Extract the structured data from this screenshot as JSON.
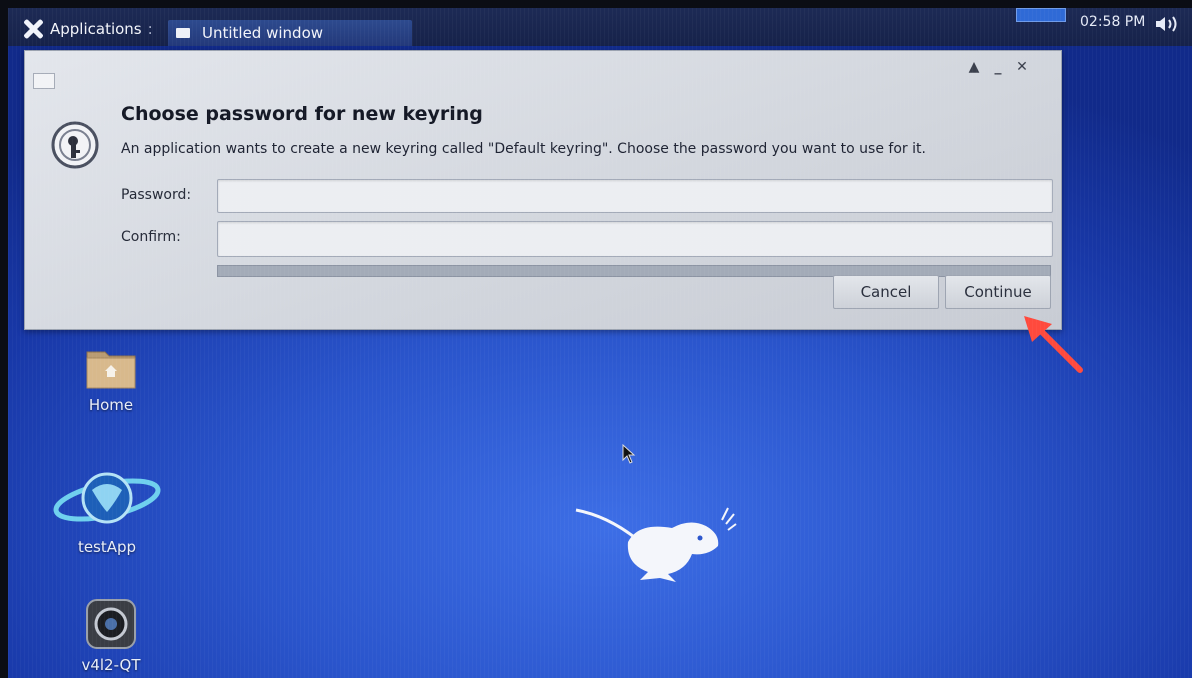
{
  "top_panel": {
    "applications_label": "Applications",
    "separator": ":",
    "taskbar_window_title": "Untitled window",
    "clock": "02:58 PM"
  },
  "dialog": {
    "heading": "Choose password for new keyring",
    "message": "An application wants to create a new keyring called \"Default keyring\". Choose the password you want to use for it.",
    "password_label": "Password:",
    "confirm_label": "Confirm:",
    "password_value": "",
    "confirm_value": "",
    "cancel_label": "Cancel",
    "continue_label": "Continue",
    "wm_buttons": {
      "shade": "▲",
      "minimize": "_",
      "close": "✕"
    }
  },
  "desktop": {
    "icons": [
      {
        "label": "Home",
        "icon": "home-folder-icon"
      },
      {
        "label": "testApp",
        "icon": "testapp-icon"
      },
      {
        "label": "v4l2-QT",
        "icon": "camera-icon"
      }
    ]
  },
  "colors": {
    "desktop_blue": "#2a55cc",
    "panel": "#1d2a55",
    "annotation_arrow": "#ff4a3d"
  }
}
